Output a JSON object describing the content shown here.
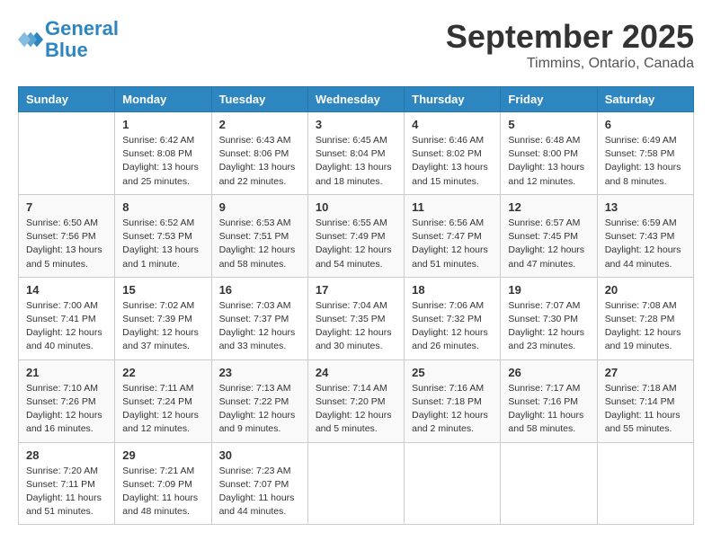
{
  "header": {
    "logo_line1": "General",
    "logo_line2": "Blue",
    "month": "September 2025",
    "location": "Timmins, Ontario, Canada"
  },
  "weekdays": [
    "Sunday",
    "Monday",
    "Tuesday",
    "Wednesday",
    "Thursday",
    "Friday",
    "Saturday"
  ],
  "weeks": [
    [
      {
        "day": "",
        "info": ""
      },
      {
        "day": "1",
        "info": "Sunrise: 6:42 AM\nSunset: 8:08 PM\nDaylight: 13 hours\nand 25 minutes."
      },
      {
        "day": "2",
        "info": "Sunrise: 6:43 AM\nSunset: 8:06 PM\nDaylight: 13 hours\nand 22 minutes."
      },
      {
        "day": "3",
        "info": "Sunrise: 6:45 AM\nSunset: 8:04 PM\nDaylight: 13 hours\nand 18 minutes."
      },
      {
        "day": "4",
        "info": "Sunrise: 6:46 AM\nSunset: 8:02 PM\nDaylight: 13 hours\nand 15 minutes."
      },
      {
        "day": "5",
        "info": "Sunrise: 6:48 AM\nSunset: 8:00 PM\nDaylight: 13 hours\nand 12 minutes."
      },
      {
        "day": "6",
        "info": "Sunrise: 6:49 AM\nSunset: 7:58 PM\nDaylight: 13 hours\nand 8 minutes."
      }
    ],
    [
      {
        "day": "7",
        "info": "Sunrise: 6:50 AM\nSunset: 7:56 PM\nDaylight: 13 hours\nand 5 minutes."
      },
      {
        "day": "8",
        "info": "Sunrise: 6:52 AM\nSunset: 7:53 PM\nDaylight: 13 hours\nand 1 minute."
      },
      {
        "day": "9",
        "info": "Sunrise: 6:53 AM\nSunset: 7:51 PM\nDaylight: 12 hours\nand 58 minutes."
      },
      {
        "day": "10",
        "info": "Sunrise: 6:55 AM\nSunset: 7:49 PM\nDaylight: 12 hours\nand 54 minutes."
      },
      {
        "day": "11",
        "info": "Sunrise: 6:56 AM\nSunset: 7:47 PM\nDaylight: 12 hours\nand 51 minutes."
      },
      {
        "day": "12",
        "info": "Sunrise: 6:57 AM\nSunset: 7:45 PM\nDaylight: 12 hours\nand 47 minutes."
      },
      {
        "day": "13",
        "info": "Sunrise: 6:59 AM\nSunset: 7:43 PM\nDaylight: 12 hours\nand 44 minutes."
      }
    ],
    [
      {
        "day": "14",
        "info": "Sunrise: 7:00 AM\nSunset: 7:41 PM\nDaylight: 12 hours\nand 40 minutes."
      },
      {
        "day": "15",
        "info": "Sunrise: 7:02 AM\nSunset: 7:39 PM\nDaylight: 12 hours\nand 37 minutes."
      },
      {
        "day": "16",
        "info": "Sunrise: 7:03 AM\nSunset: 7:37 PM\nDaylight: 12 hours\nand 33 minutes."
      },
      {
        "day": "17",
        "info": "Sunrise: 7:04 AM\nSunset: 7:35 PM\nDaylight: 12 hours\nand 30 minutes."
      },
      {
        "day": "18",
        "info": "Sunrise: 7:06 AM\nSunset: 7:32 PM\nDaylight: 12 hours\nand 26 minutes."
      },
      {
        "day": "19",
        "info": "Sunrise: 7:07 AM\nSunset: 7:30 PM\nDaylight: 12 hours\nand 23 minutes."
      },
      {
        "day": "20",
        "info": "Sunrise: 7:08 AM\nSunset: 7:28 PM\nDaylight: 12 hours\nand 19 minutes."
      }
    ],
    [
      {
        "day": "21",
        "info": "Sunrise: 7:10 AM\nSunset: 7:26 PM\nDaylight: 12 hours\nand 16 minutes."
      },
      {
        "day": "22",
        "info": "Sunrise: 7:11 AM\nSunset: 7:24 PM\nDaylight: 12 hours\nand 12 minutes."
      },
      {
        "day": "23",
        "info": "Sunrise: 7:13 AM\nSunset: 7:22 PM\nDaylight: 12 hours\nand 9 minutes."
      },
      {
        "day": "24",
        "info": "Sunrise: 7:14 AM\nSunset: 7:20 PM\nDaylight: 12 hours\nand 5 minutes."
      },
      {
        "day": "25",
        "info": "Sunrise: 7:16 AM\nSunset: 7:18 PM\nDaylight: 12 hours\nand 2 minutes."
      },
      {
        "day": "26",
        "info": "Sunrise: 7:17 AM\nSunset: 7:16 PM\nDaylight: 11 hours\nand 58 minutes."
      },
      {
        "day": "27",
        "info": "Sunrise: 7:18 AM\nSunset: 7:14 PM\nDaylight: 11 hours\nand 55 minutes."
      }
    ],
    [
      {
        "day": "28",
        "info": "Sunrise: 7:20 AM\nSunset: 7:11 PM\nDaylight: 11 hours\nand 51 minutes."
      },
      {
        "day": "29",
        "info": "Sunrise: 7:21 AM\nSunset: 7:09 PM\nDaylight: 11 hours\nand 48 minutes."
      },
      {
        "day": "30",
        "info": "Sunrise: 7:23 AM\nSunset: 7:07 PM\nDaylight: 11 hours\nand 44 minutes."
      },
      {
        "day": "",
        "info": ""
      },
      {
        "day": "",
        "info": ""
      },
      {
        "day": "",
        "info": ""
      },
      {
        "day": "",
        "info": ""
      }
    ]
  ]
}
